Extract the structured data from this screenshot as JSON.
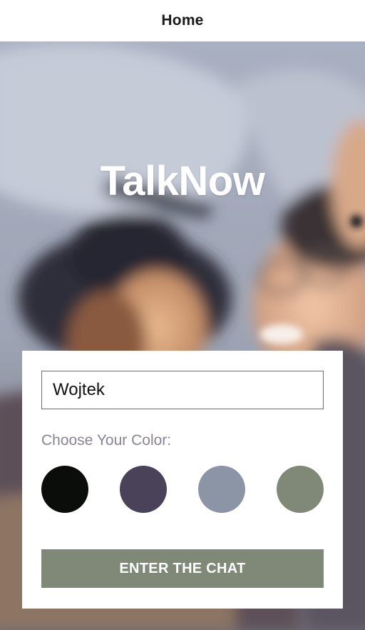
{
  "navbar": {
    "title": "Home"
  },
  "hero": {
    "app_title": "TalkNow"
  },
  "form": {
    "name_value": "Wojtek",
    "color_label": "Choose Your Color:",
    "colors": [
      "#090C08",
      "#474056",
      "#8A95A5",
      "#B9C6AE"
    ],
    "colors_rendered": [
      "#0b0d0a",
      "#4a4259",
      "#8c95a6",
      "#808878"
    ],
    "button_label": "ENTER THE CHAT",
    "button_color": "#808878"
  }
}
